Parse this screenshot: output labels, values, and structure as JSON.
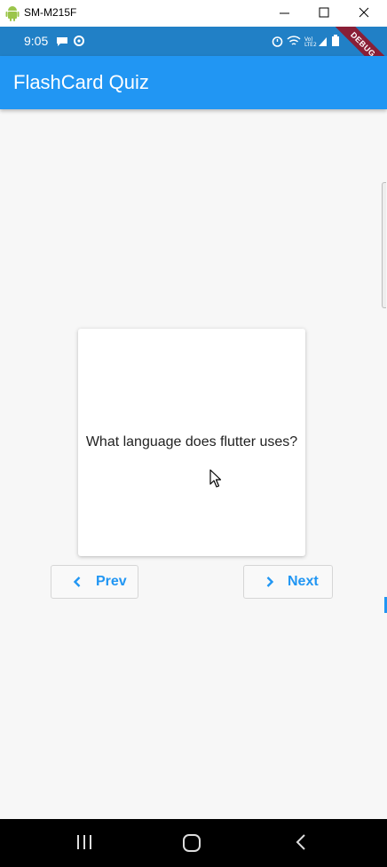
{
  "window": {
    "title": "SM-M215F",
    "icons": [
      "android-icon",
      "minimize-icon",
      "maximize-icon",
      "close-icon"
    ]
  },
  "status_bar": {
    "time": "9:05",
    "icons": [
      "message-icon",
      "sync-icon",
      "alarm-icon",
      "wifi-icon",
      "signal-icon",
      "battery-icon"
    ],
    "debug_label": "DEBUG",
    "color": "#2180c6"
  },
  "app_bar": {
    "title": "FlashCard Quiz",
    "color": "#2196f3"
  },
  "card": {
    "question": "What language does flutter uses?"
  },
  "buttons": {
    "prev_label": "Prev",
    "next_label": "Next",
    "accent": "#2196f3"
  },
  "nav_bar": {
    "icons": [
      "recent-apps-icon",
      "home-icon",
      "back-icon"
    ]
  }
}
